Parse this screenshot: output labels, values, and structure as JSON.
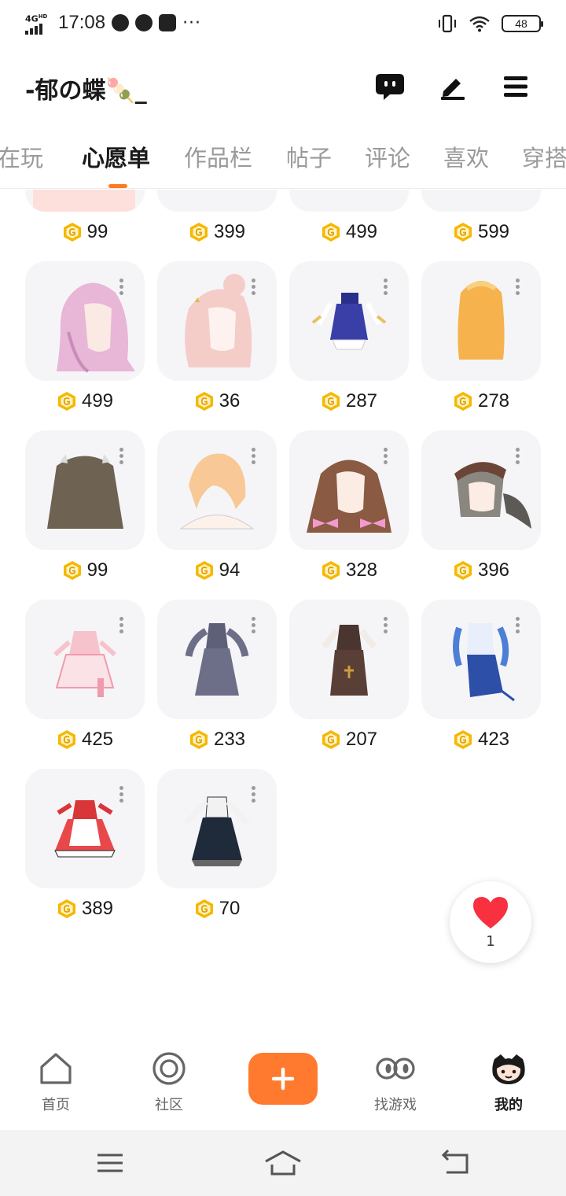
{
  "status_bar": {
    "network": "4G",
    "network_sub": "HD",
    "time": "17:08",
    "more": "···",
    "battery": "48"
  },
  "header": {
    "username": "-郁の蝶🍡_"
  },
  "tabs": [
    {
      "label": "正在玩",
      "active": false
    },
    {
      "label": "心愿单",
      "active": true
    },
    {
      "label": "作品栏",
      "active": false
    },
    {
      "label": "帖子",
      "active": false
    },
    {
      "label": "评论",
      "active": false
    },
    {
      "label": "喜欢",
      "active": false
    },
    {
      "label": "穿搭",
      "active": false
    }
  ],
  "wishlist": {
    "partial_row_prices": [
      "99",
      "399",
      "499",
      "599"
    ],
    "items": [
      {
        "price": "499",
        "icon": "pink-hair-icon"
      },
      {
        "price": "36",
        "icon": "pink-hair-bun-icon"
      },
      {
        "price": "287",
        "icon": "blue-outfit-icon"
      },
      {
        "price": "278",
        "icon": "orange-hair-icon"
      },
      {
        "price": "99",
        "icon": "brown-long-hair-icon"
      },
      {
        "price": "94",
        "icon": "peach-short-hair-icon"
      },
      {
        "price": "328",
        "icon": "brown-wavy-hair-icon"
      },
      {
        "price": "396",
        "icon": "grey-ponytail-hair-icon"
      },
      {
        "price": "425",
        "icon": "pink-dress-icon"
      },
      {
        "price": "233",
        "icon": "grey-gown-icon"
      },
      {
        "price": "207",
        "icon": "brown-nun-dress-icon"
      },
      {
        "price": "423",
        "icon": "blue-white-dress-icon"
      },
      {
        "price": "389",
        "icon": "red-maid-dress-icon"
      },
      {
        "price": "70",
        "icon": "black-lace-dress-icon"
      }
    ]
  },
  "like_fab": {
    "count": "1"
  },
  "bottom_nav": [
    {
      "label": "首页",
      "icon": "home-icon"
    },
    {
      "label": "社区",
      "icon": "community-icon"
    },
    {
      "label": "",
      "icon": "plus-icon"
    },
    {
      "label": "找游戏",
      "icon": "find-game-icon"
    },
    {
      "label": "我的",
      "icon": "profile-cat-icon"
    }
  ],
  "colors": {
    "accent": "#ff7a2e",
    "coin": "#f5b800",
    "card_bg": "#f5f5f8"
  }
}
